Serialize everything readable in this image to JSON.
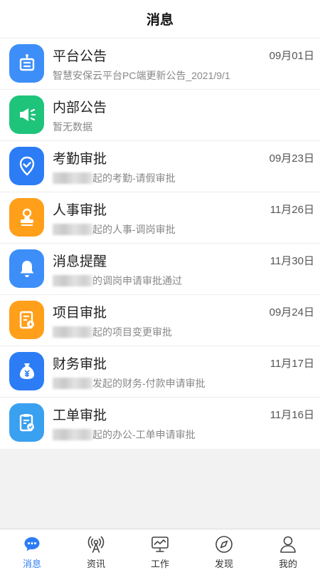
{
  "header": {
    "title": "消息"
  },
  "messages": [
    {
      "title": "平台公告",
      "subtitle": "智慧安保云平台PC端更新公告_2021/9/1",
      "date": "09月01日",
      "icon": "notice-board-icon",
      "color": "#3d8ef8"
    },
    {
      "title": "内部公告",
      "subtitle": "暂无数据",
      "date": "",
      "icon": "megaphone-icon",
      "color": "#1ec47a"
    },
    {
      "title": "考勤审批",
      "subtitle": "起的考勤-请假审批",
      "date": "09月23日",
      "icon": "location-check-icon",
      "color": "#2c7cf6"
    },
    {
      "title": "人事审批",
      "subtitle": "起的人事-调岗审批",
      "date": "11月26日",
      "icon": "stamp-icon",
      "color": "#ff9f1a"
    },
    {
      "title": "消息提醒",
      "subtitle": "的调岗申请审批通过",
      "date": "11月30日",
      "icon": "bell-icon",
      "color": "#3d8ef8"
    },
    {
      "title": "项目审批",
      "subtitle": "起的项目变更审批",
      "date": "09月24日",
      "icon": "document-icon",
      "color": "#ff9f1a"
    },
    {
      "title": "财务审批",
      "subtitle": "发起的财务-付款申请审批",
      "date": "11月17日",
      "icon": "money-bag-icon",
      "color": "#2c7cf6"
    },
    {
      "title": "工单审批",
      "subtitle": "起的办公-工单申请审批",
      "date": "11月16日",
      "icon": "clipboard-check-icon",
      "color": "#3aa0f0"
    }
  ],
  "tabs": [
    {
      "label": "消息",
      "icon": "chat-bubble-icon",
      "active": true
    },
    {
      "label": "资讯",
      "icon": "broadcast-icon",
      "active": false
    },
    {
      "label": "工作",
      "icon": "monitor-chart-icon",
      "active": false
    },
    {
      "label": "发现",
      "icon": "compass-icon",
      "active": false
    },
    {
      "label": "我的",
      "icon": "user-icon",
      "active": false
    }
  ],
  "colors": {
    "accent": "#2c7cf6"
  }
}
